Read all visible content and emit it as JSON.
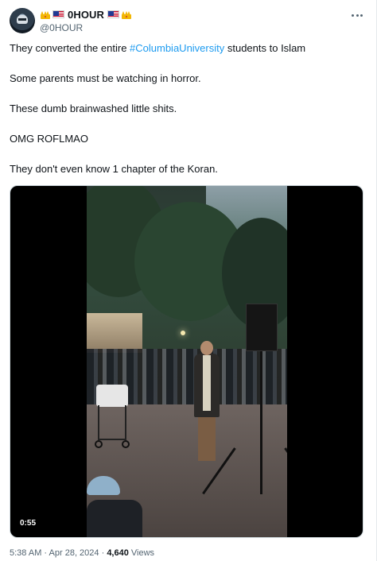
{
  "author": {
    "display_name": "0HOUR",
    "handle": "@0HOUR",
    "name_emojis_left": [
      "crown-emoji",
      "us-flag-emoji"
    ],
    "name_emojis_right": [
      "us-flag-emoji",
      "crown-emoji"
    ]
  },
  "tweet": {
    "line1_before": "They converted the entire ",
    "line1_hashtag": "#ColumbiaUniversity",
    "line1_after": " students to Islam",
    "line2": "Some parents must be watching in horror.",
    "line3": "These dumb brainwashed little shits.",
    "line4": "OMG ROFLMAO",
    "line5": "They don't even know 1 chapter of the Koran."
  },
  "video": {
    "duration": "0:55"
  },
  "meta": {
    "time": "5:38 AM",
    "separator1": " · ",
    "date": "Apr 28, 2024",
    "separator2": " · ",
    "views_count": "4,640",
    "views_label": " Views"
  },
  "colors": {
    "text": "#0f1419",
    "secondary": "#536471",
    "link": "#1d9bf0",
    "accent_crown": "#f2b705"
  }
}
